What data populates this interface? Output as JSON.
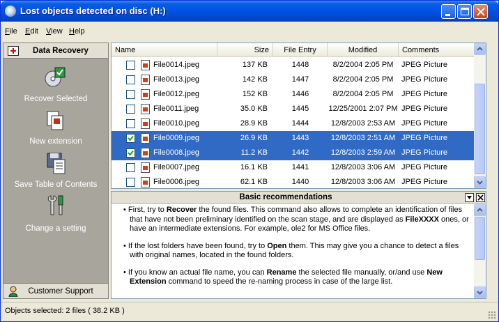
{
  "window": {
    "title": "Lost objects detected on disc (H:)"
  },
  "menu": [
    {
      "label": "File",
      "key": "F"
    },
    {
      "label": "Edit",
      "key": "E"
    },
    {
      "label": "View",
      "key": "V"
    },
    {
      "label": "Help",
      "key": "H"
    }
  ],
  "left_pane": {
    "header": "Data Recovery",
    "actions": [
      {
        "label": "Recover Selected",
        "icon": "recover-icon"
      },
      {
        "label": "New extension",
        "icon": "new-extension-icon"
      },
      {
        "label": "Save Table of Contents",
        "icon": "save-toc-icon"
      },
      {
        "label": "Change a setting",
        "icon": "settings-icon"
      }
    ],
    "footer": "Customer Support"
  },
  "file_list": {
    "columns": [
      "Name",
      "Size",
      "File Entry",
      "Modified",
      "Comments"
    ],
    "rows": [
      {
        "checked": false,
        "selected": false,
        "name": "File0014.jpeg",
        "size": "137 KB",
        "entry": "1448",
        "modified": "8/2/2004 2:05 PM",
        "comment": "JPEG Picture"
      },
      {
        "checked": false,
        "selected": false,
        "name": "File0013.jpeg",
        "size": "142 KB",
        "entry": "1447",
        "modified": "8/2/2004 2:05 PM",
        "comment": "JPEG Picture"
      },
      {
        "checked": false,
        "selected": false,
        "name": "File0012.jpeg",
        "size": "152 KB",
        "entry": "1446",
        "modified": "8/2/2004 2:05 PM",
        "comment": "JPEG Picture"
      },
      {
        "checked": false,
        "selected": false,
        "name": "File0011.jpeg",
        "size": "35.0 KB",
        "entry": "1445",
        "modified": "12/25/2001 2:07 PM",
        "comment": "JPEG Picture"
      },
      {
        "checked": false,
        "selected": false,
        "name": "File0010.jpeg",
        "size": "28.9 KB",
        "entry": "1444",
        "modified": "12/8/2003 2:53 AM",
        "comment": "JPEG Picture"
      },
      {
        "checked": true,
        "selected": true,
        "name": "File0009.jpeg",
        "size": "26.9 KB",
        "entry": "1443",
        "modified": "12/8/2003 2:51 AM",
        "comment": "JPEG Picture"
      },
      {
        "checked": true,
        "selected": true,
        "name": "File0008.jpeg",
        "size": "11.2 KB",
        "entry": "1442",
        "modified": "12/8/2003 2:59 AM",
        "comment": "JPEG Picture"
      },
      {
        "checked": false,
        "selected": false,
        "name": "File0007.jpeg",
        "size": "16.1 KB",
        "entry": "1441",
        "modified": "12/8/2003 3:06 AM",
        "comment": "JPEG Picture"
      },
      {
        "checked": false,
        "selected": false,
        "name": "File0006.jpeg",
        "size": "62.1 KB",
        "entry": "1440",
        "modified": "12/8/2003 3:06 AM",
        "comment": "JPEG Picture"
      }
    ]
  },
  "recommendations": {
    "title": "Basic recommendations",
    "paragraphs": [
      [
        "• First, try to ",
        {
          "b": "Recover"
        },
        " the found files. This command also allows to complete an identification of files that have not been preliminary identified on the scan stage, and are displayed as ",
        {
          "b": "FileXXXX"
        },
        " ones, or have an intermediate extensions. For example, ole2 for MS Office files."
      ],
      [
        "• If the lost folders have been found, try to ",
        {
          "b": "Open"
        },
        " them. This may give you a chance to detect a files with original names, located in the found folders."
      ],
      [
        "• If you know an actual file name, you can ",
        {
          "b": "Rename"
        },
        " the selected file manually, or/and use ",
        {
          "b": "New Extension"
        },
        " command to speed the re-naming process in case of the large list."
      ]
    ]
  },
  "status": {
    "text": "Objects selected: 2 files ( 38.2 KB )"
  },
  "colors": {
    "title_bar": "#0054e3",
    "selection": "#316ac5",
    "left_pane": "#a7a59c"
  }
}
